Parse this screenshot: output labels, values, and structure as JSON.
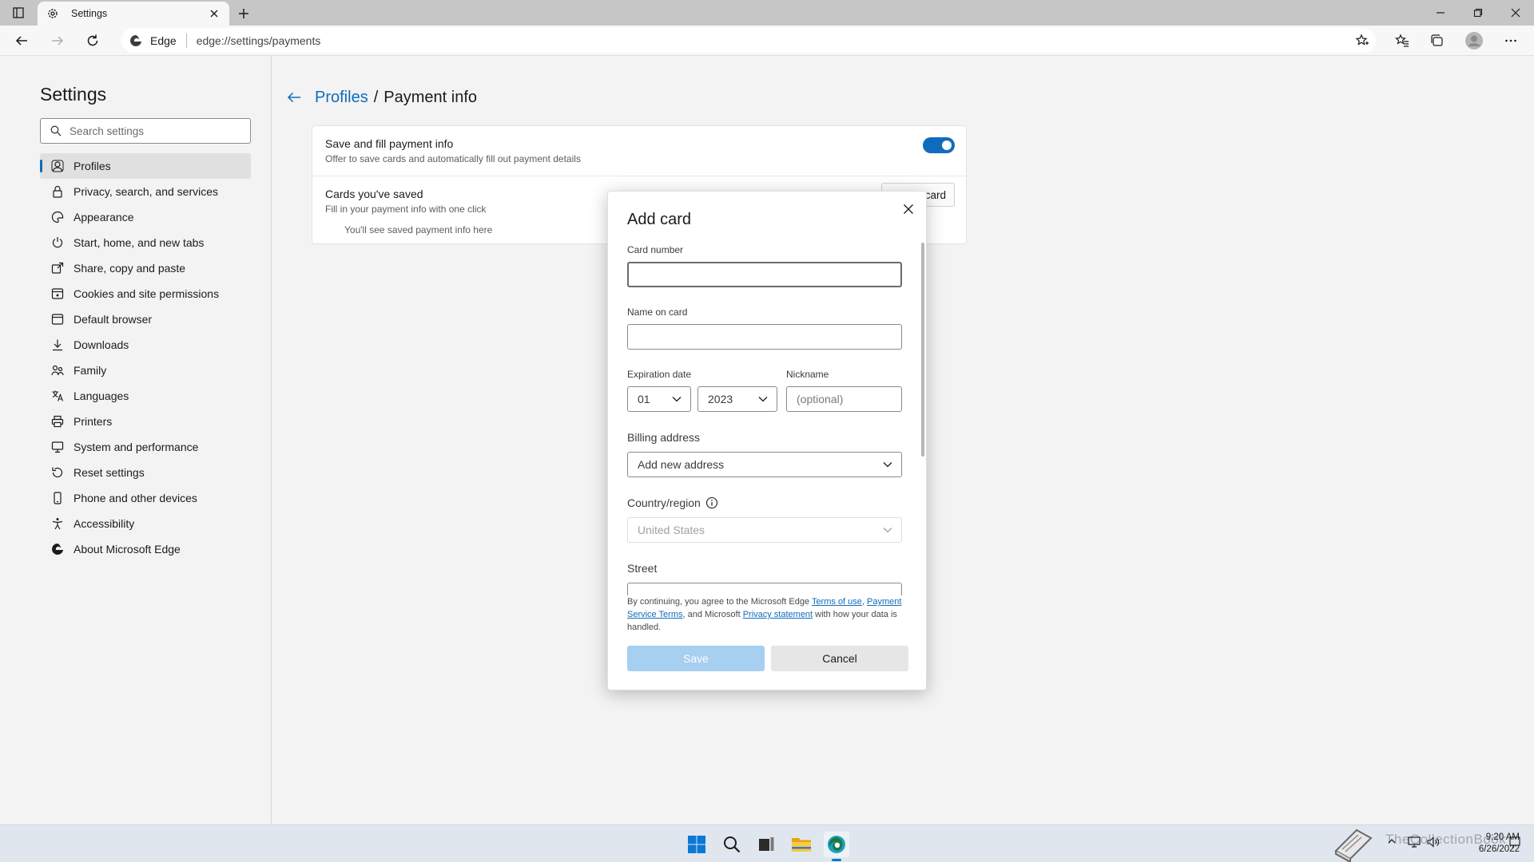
{
  "browser": {
    "tab_title": "Settings",
    "brand": "Edge",
    "url": "edge://settings/payments"
  },
  "sidebar": {
    "title": "Settings",
    "search_placeholder": "Search settings",
    "items": [
      {
        "label": "Profiles",
        "icon": "profile-icon",
        "active": true
      },
      {
        "label": "Privacy, search, and services",
        "icon": "lock-icon"
      },
      {
        "label": "Appearance",
        "icon": "appearance-icon"
      },
      {
        "label": "Start, home, and new tabs",
        "icon": "power-icon"
      },
      {
        "label": "Share, copy and paste",
        "icon": "share-icon"
      },
      {
        "label": "Cookies and site permissions",
        "icon": "cookie-icon"
      },
      {
        "label": "Default browser",
        "icon": "browser-icon"
      },
      {
        "label": "Downloads",
        "icon": "download-icon"
      },
      {
        "label": "Family",
        "icon": "family-icon"
      },
      {
        "label": "Languages",
        "icon": "language-icon"
      },
      {
        "label": "Printers",
        "icon": "printer-icon"
      },
      {
        "label": "System and performance",
        "icon": "system-icon"
      },
      {
        "label": "Reset settings",
        "icon": "reset-icon"
      },
      {
        "label": "Phone and other devices",
        "icon": "phone-icon"
      },
      {
        "label": "Accessibility",
        "icon": "accessibility-icon"
      },
      {
        "label": "About Microsoft Edge",
        "icon": "edge-icon"
      }
    ]
  },
  "main": {
    "breadcrumb_parent": "Profiles",
    "breadcrumb_sep": "/",
    "breadcrumb_current": "Payment info",
    "save_fill_title": "Save and fill payment info",
    "save_fill_desc": "Offer to save cards and automatically fill out payment details",
    "cards_title": "Cards you've saved",
    "cards_desc": "Fill in your payment info with one click",
    "add_card_button": "card",
    "empty_text": "You'll see saved payment info here"
  },
  "modal": {
    "title": "Add card",
    "card_number_label": "Card number",
    "name_label": "Name on card",
    "expiration_label": "Expiration date",
    "month": "01",
    "year": "2023",
    "nickname_label": "Nickname",
    "nickname_placeholder": "(optional)",
    "billing_label": "Billing address",
    "billing_value": "Add new address",
    "country_label": "Country/region",
    "country_value": "United States",
    "street_label": "Street",
    "legal_prefix": "By continuing, you agree to the Microsoft Edge ",
    "terms_link": "Terms of use",
    "legal_comma": ", ",
    "payment_terms_link": "Payment Service Terms",
    "legal_mid": ", and Microsoft ",
    "privacy_link": "Privacy statement",
    "legal_suffix": " with how your data is handled.",
    "save_button": "Save",
    "cancel_button": "Cancel"
  },
  "taskbar": {
    "time": "9:20 AM",
    "date": "6/26/2022",
    "watermark": "TheCollectionBook"
  },
  "colors": {
    "accent": "#0f6cbd",
    "save_disabled": "#a6cff0"
  }
}
